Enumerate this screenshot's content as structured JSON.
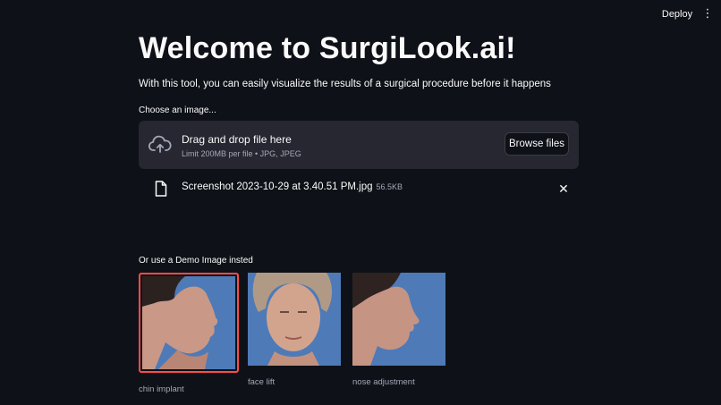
{
  "header": {
    "deploy_label": "Deploy",
    "menu_icon": "more-vertical-icon"
  },
  "title": "Welcome to SurgiLook.ai!",
  "subtitle": "With this tool, you can easily visualize the results of a surgical procedure before it happens",
  "uploader": {
    "label": "Choose an image...",
    "drop_text": "Drag and drop file here",
    "limit_text": "Limit 200MB per file • JPG, JPEG",
    "browse_label": "Browse files",
    "icon": "cloud-upload-icon"
  },
  "uploaded_file": {
    "name": "Screenshot 2023-10-29 at 3.40.51 PM.jpg",
    "size": "56.5KB",
    "icon": "file-icon",
    "remove_icon": "close-icon"
  },
  "demo": {
    "label": "Or use a Demo Image insted",
    "images": [
      {
        "caption": "chin implant",
        "selected": true
      },
      {
        "caption": "face lift",
        "selected": false
      },
      {
        "caption": "nose adjustment",
        "selected": false
      }
    ]
  },
  "colors": {
    "background": "#0e1117",
    "panel": "#262730",
    "accent": "#ff4b4b",
    "photo_bg": "#4e7ab8"
  }
}
